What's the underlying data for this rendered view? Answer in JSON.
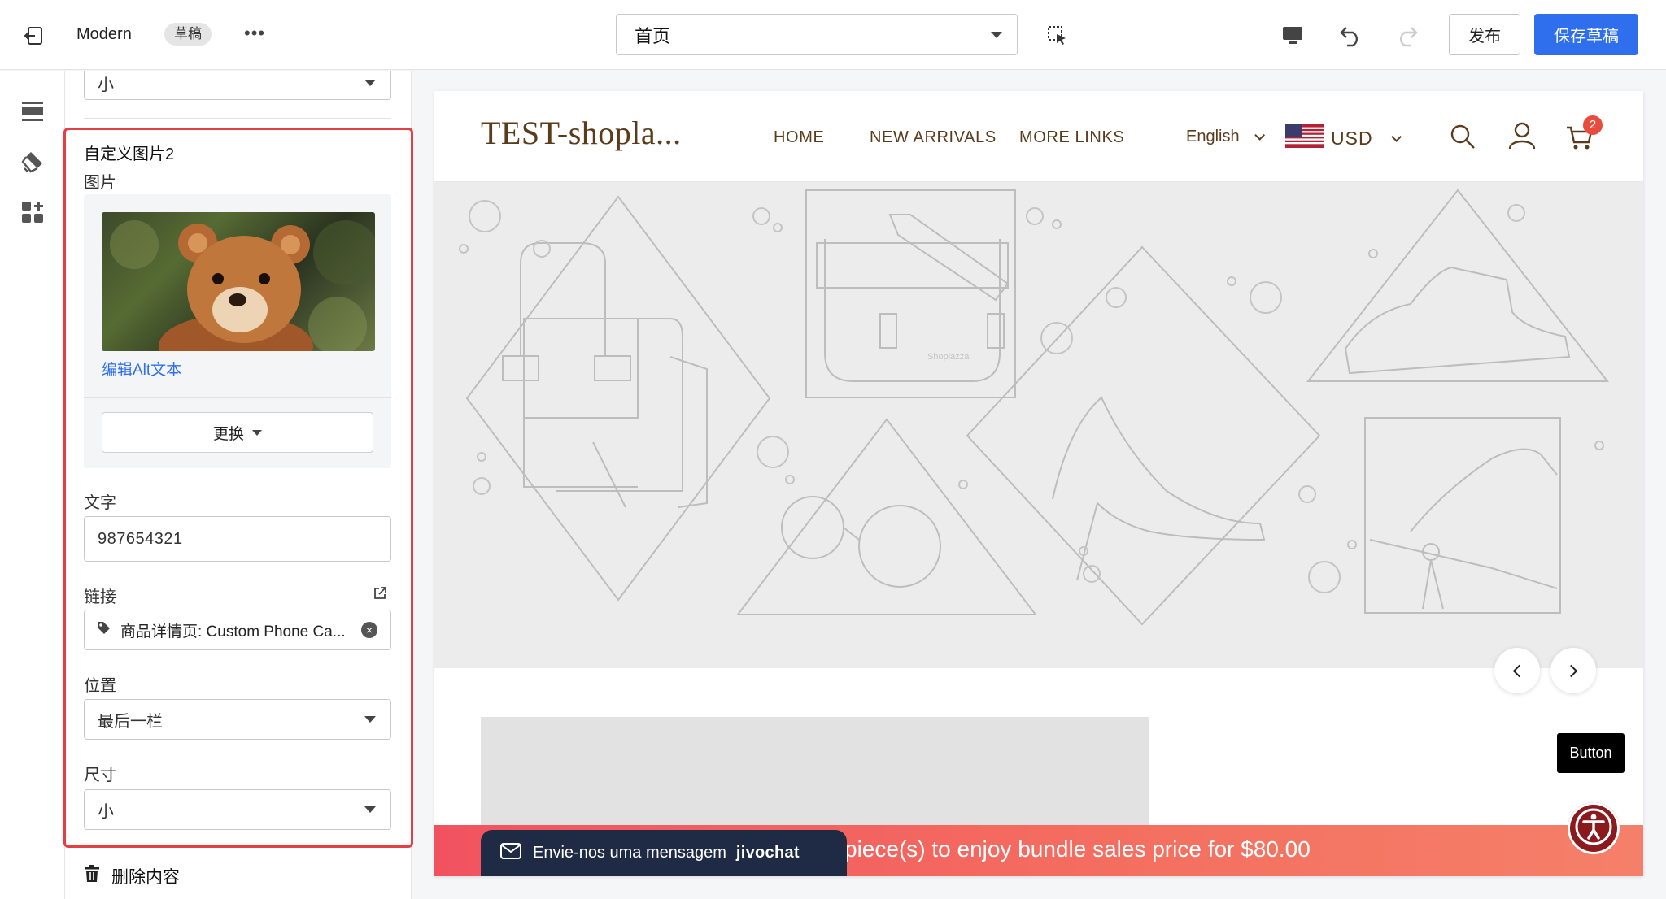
{
  "topbar": {
    "theme_name": "Modern",
    "draft_badge": "草稿",
    "more_label": "•••",
    "page_select": "首页",
    "publish_label": "发布",
    "save_draft_label": "保存草稿"
  },
  "panel": {
    "top_select_value": "小",
    "block_title": "自定义图片2",
    "image_label": "图片",
    "edit_alt_label": "编辑Alt文本",
    "replace_label": "更换",
    "text_label": "文字",
    "text_value": "987654321",
    "link_label": "链接",
    "link_value": "商品详情页: Custom Phone Ca...",
    "position_label": "位置",
    "position_value": "最后一栏",
    "size_label": "尺寸",
    "size_value": "小",
    "delete_label": "删除内容"
  },
  "preview": {
    "store_title": "TEST-shopla...",
    "nav": [
      "HOME",
      "NEW ARRIVALS",
      "MORE LINKS"
    ],
    "language": "English",
    "currency": "USD",
    "cart_count": "2",
    "float_button": "Button",
    "chat_label": "Envie-nos uma mensagem",
    "chat_brand": "jivochat",
    "promo_text": "piece(s) to enjoy bundle sales price for $80.00",
    "bag_brand": "Shoplazza"
  },
  "colors": {
    "accent": "#2f6fed",
    "highlight_border": "#e53e45",
    "promo_bar": "#f06a5e",
    "store_brown": "#5a3c1c"
  }
}
